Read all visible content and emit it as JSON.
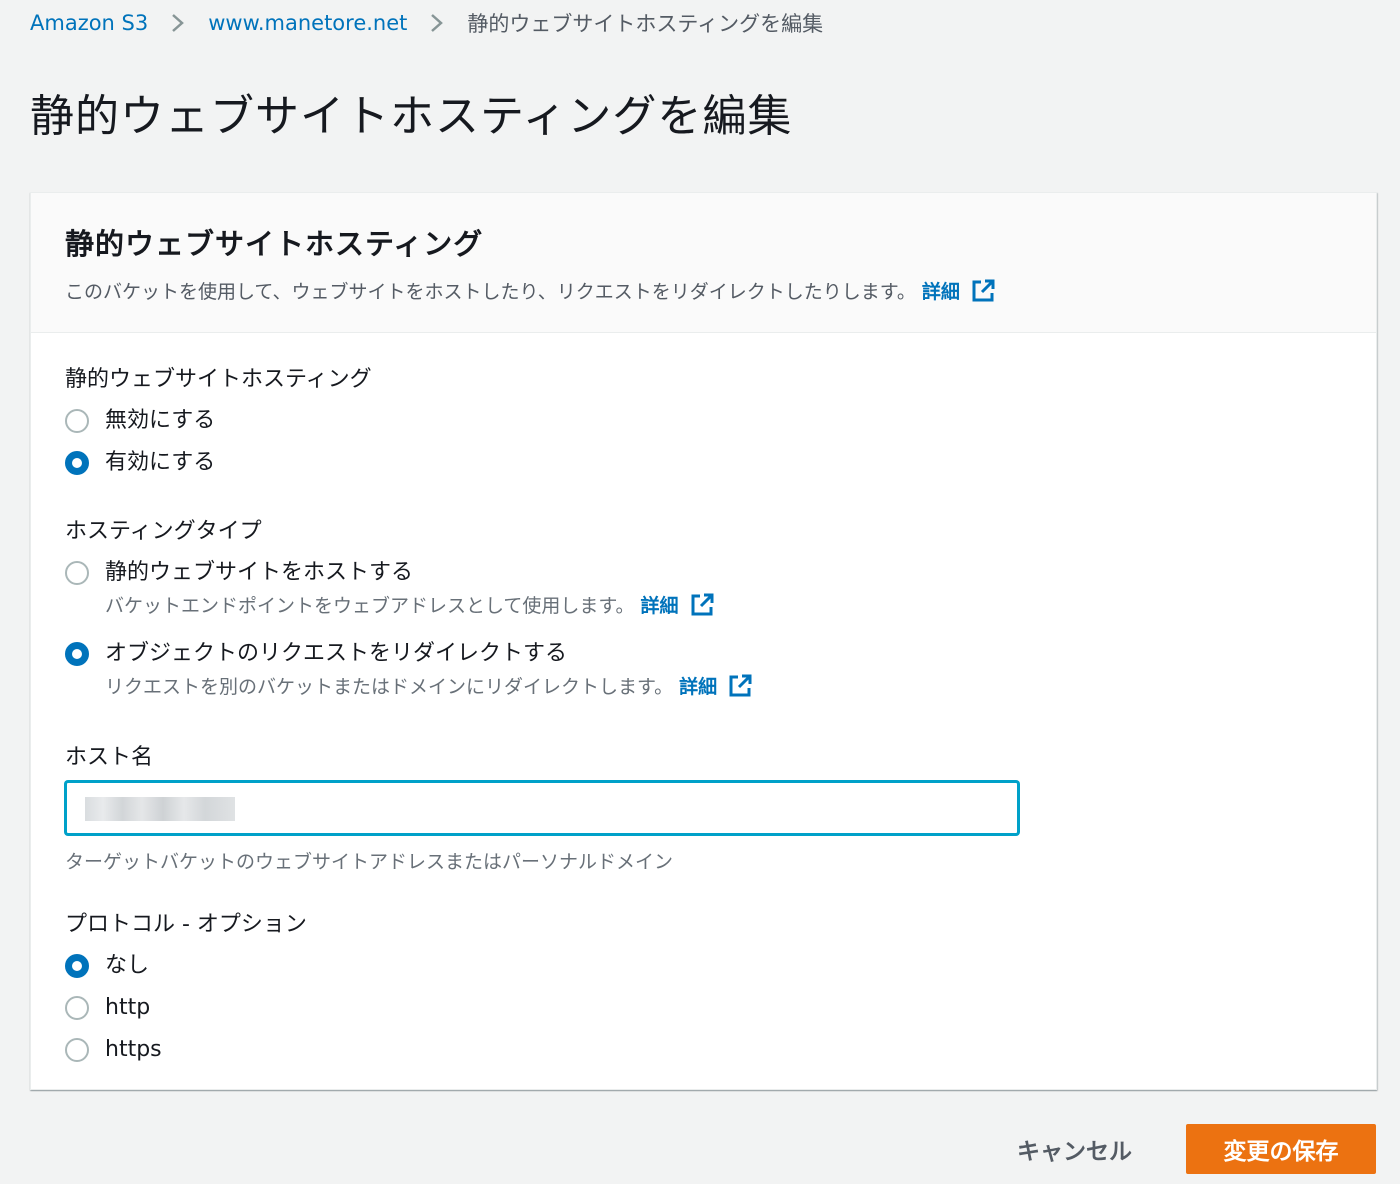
{
  "breadcrumb": {
    "items": [
      {
        "label": "Amazon S3"
      },
      {
        "label": "www.manetore.net"
      },
      {
        "label": "静的ウェブサイトホスティングを編集"
      }
    ]
  },
  "page": {
    "title": "静的ウェブサイトホスティングを編集"
  },
  "panel": {
    "title": "静的ウェブサイトホスティング",
    "description": "このバケットを使用して、ウェブサイトをホストしたり、リクエストをリダイレクトしたりします。",
    "info_link": "詳細"
  },
  "hosting": {
    "label": "静的ウェブサイトホスティング",
    "options": [
      {
        "label": "無効にする",
        "checked": false
      },
      {
        "label": "有効にする",
        "checked": true
      }
    ]
  },
  "hosting_type": {
    "label": "ホスティングタイプ",
    "options": [
      {
        "label": "静的ウェブサイトをホストする",
        "description": "バケットエンドポイントをウェブアドレスとして使用します。",
        "link": "詳細",
        "checked": false
      },
      {
        "label": "オブジェクトのリクエストをリダイレクトする",
        "description": "リクエストを別のバケットまたはドメインにリダイレクトします。",
        "link": "詳細",
        "checked": true
      }
    ]
  },
  "host_name": {
    "label": "ホスト名",
    "constraint": "ターゲットバケットのウェブサイトアドレスまたはパーソナルドメイン"
  },
  "protocol": {
    "label": "プロトコル - オプション",
    "options": [
      {
        "label": "なし",
        "checked": true
      },
      {
        "label": "http",
        "checked": false
      },
      {
        "label": "https",
        "checked": false
      }
    ]
  },
  "actions": {
    "cancel": "キャンセル",
    "save": "変更の保存"
  },
  "colors": {
    "link": "#0073bb",
    "primary": "#ec7211",
    "focus": "#00a1c9"
  }
}
